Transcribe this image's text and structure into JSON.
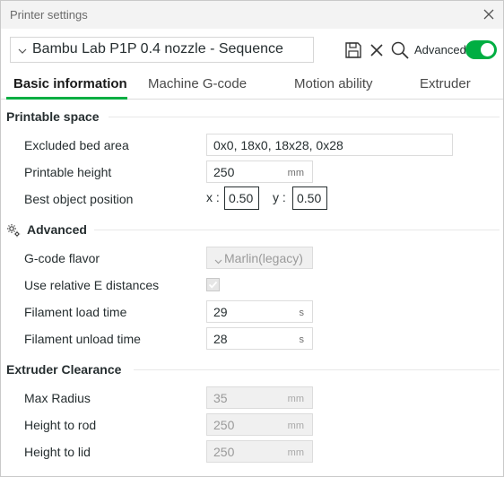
{
  "window": {
    "title": "Printer settings"
  },
  "preset": {
    "name": "Bambu Lab P1P 0.4 nozzle - Sequence"
  },
  "toolbar": {
    "advanced_label": "Advanced",
    "advanced_on": true,
    "accent_color": "#00ae42"
  },
  "tabs": [
    {
      "label": "Basic information",
      "active": true
    },
    {
      "label": "Machine G-code",
      "active": false
    },
    {
      "label": "Motion ability",
      "active": false
    },
    {
      "label": "Extruder",
      "active": false
    }
  ],
  "printable_space": {
    "title": "Printable space",
    "excluded_bed_area": {
      "label": "Excluded bed area",
      "value": "0x0, 18x0, 18x28, 0x28"
    },
    "printable_height": {
      "label": "Printable height",
      "value": "250",
      "unit": "mm"
    },
    "best_object_position": {
      "label": "Best object position",
      "x_label": "x :",
      "x_value": "0.50",
      "y_label": "y :",
      "y_value": "0.50"
    }
  },
  "advanced": {
    "title": "Advanced",
    "gcode_flavor": {
      "label": "G-code flavor",
      "value": "Marlin(legacy)"
    },
    "relative_e": {
      "label": "Use relative E distances",
      "checked": true
    },
    "filament_load_time": {
      "label": "Filament load time",
      "value": "29",
      "unit": "s"
    },
    "filament_unload_time": {
      "label": "Filament unload time",
      "value": "28",
      "unit": "s"
    }
  },
  "extruder_clearance": {
    "title": "Extruder Clearance",
    "max_radius": {
      "label": "Max Radius",
      "value": "35",
      "unit": "mm"
    },
    "height_to_rod": {
      "label": "Height to rod",
      "value": "250",
      "unit": "mm"
    },
    "height_to_lid": {
      "label": "Height to lid",
      "value": "250",
      "unit": "mm"
    }
  }
}
